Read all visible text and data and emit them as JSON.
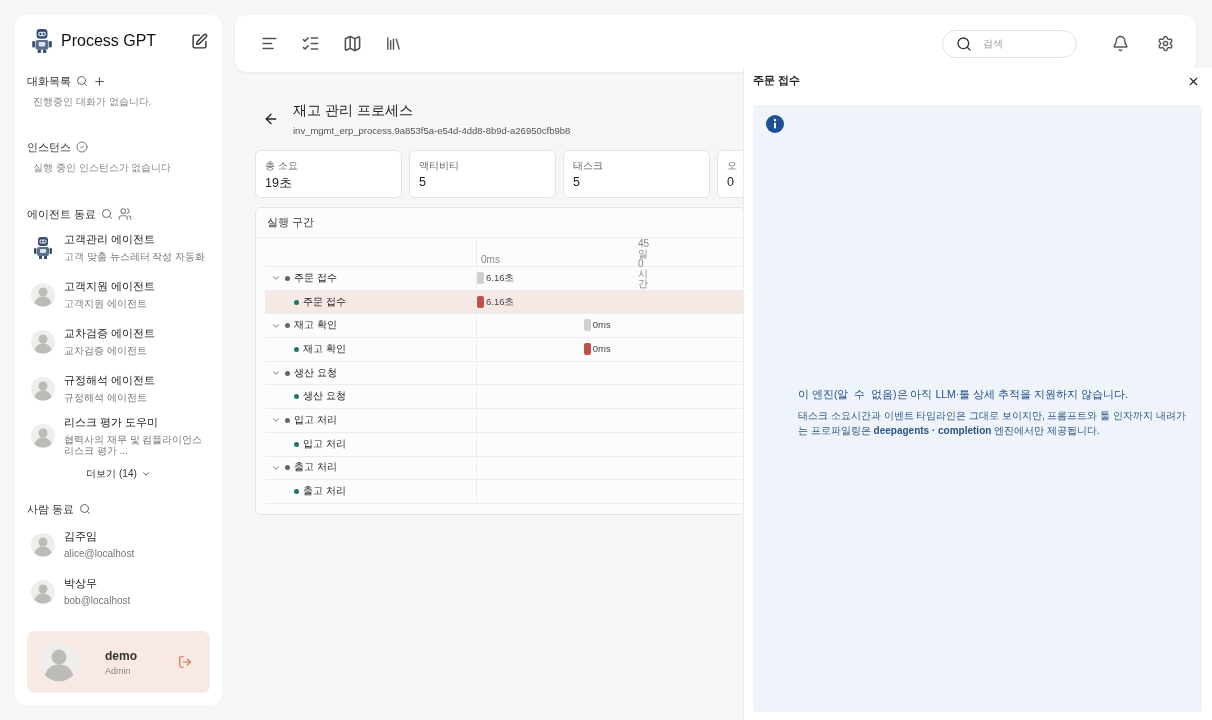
{
  "sidebar": {
    "brand": "Process GPT",
    "conversations": {
      "title": "대화목록",
      "empty": "진행중인 대화가 없습니다."
    },
    "instances": {
      "title": "인스턴스",
      "empty": "실행 중인 인스턴스가 없습니다"
    },
    "agents": {
      "title": "에이전트 동료",
      "items": [
        {
          "name": "고객관리 에이전트",
          "desc": "고객 맞춤 뉴스레터 작성 자동화",
          "kind": "robot"
        },
        {
          "name": "고객지원 에이전트",
          "desc": "고객지원 에이전트",
          "kind": "person"
        },
        {
          "name": "교차검증 에이전트",
          "desc": "교차검증 에이전트",
          "kind": "person"
        },
        {
          "name": "규정해석 에이전트",
          "desc": "규정해석 에이전트",
          "kind": "person"
        },
        {
          "name": "리스크 평가 도우미",
          "desc": "협력사의 재무 및 컴플라이언스 리스크 평가 ...",
          "kind": "person"
        }
      ],
      "more": "더보기 (14)"
    },
    "people": {
      "title": "사람 동료",
      "items": [
        {
          "name": "김주임",
          "email": "alice@localhost"
        },
        {
          "name": "박상무",
          "email": "bob@localhost"
        }
      ]
    },
    "user": {
      "name": "demo",
      "role": "Admin"
    }
  },
  "topbar": {
    "search": {
      "placeholder": "검색"
    }
  },
  "process": {
    "title": "재고 관리 프로세스",
    "id": "inv_mgmt_erp_process.9a853f5a-e54d-4dd8-8b9d-a26950cfb9b8",
    "stats": [
      {
        "label": "총 소요",
        "value": "19초"
      },
      {
        "label": "액티비티",
        "value": "5"
      },
      {
        "label": "태스크",
        "value": "5"
      },
      {
        "label": "오",
        "value": "0"
      }
    ],
    "timeline": {
      "title": "실행 구간",
      "ticks": [
        "0ms",
        "45일 0시간"
      ],
      "rows": [
        {
          "name": "주문 접수",
          "expanded": true,
          "bar": {
            "level": 0,
            "label": "6.16초"
          },
          "children": [
            {
              "name": "주문 접수",
              "selected": true,
              "bar": {
                "level": 0,
                "label": "6.16초"
              }
            }
          ]
        },
        {
          "name": "재고 확인",
          "expanded": true,
          "bar": {
            "level": 0.4,
            "label": "0ms"
          },
          "children": [
            {
              "name": "재고 확인",
              "selected": false,
              "bar": {
                "level": 0.4,
                "label": "0ms"
              }
            }
          ]
        },
        {
          "name": "생산 요청",
          "expanded": true,
          "children": [
            {
              "name": "생산 요청",
              "selected": false
            }
          ]
        },
        {
          "name": "입고 처리",
          "expanded": true,
          "children": [
            {
              "name": "입고 처리",
              "selected": false
            }
          ]
        },
        {
          "name": "출고 처리",
          "expanded": true,
          "children": [
            {
              "name": "출고 처리",
              "selected": false
            }
          ]
        }
      ]
    }
  },
  "detail_panel": {
    "title": "주문 접수",
    "notice": {
      "heading": "이 엔진(알  수  없음)은 아직 LLM·툴 상세 추적을 지원하지 않습니다.",
      "body": "태스크 소요시간과 이벤트 타임라인은 그대로 보이지만, 프롬프트와 툴 인자까지 내려가는 프로파일링은 **deepagents · completion** 엔진에서만 제공됩니다."
    }
  }
}
